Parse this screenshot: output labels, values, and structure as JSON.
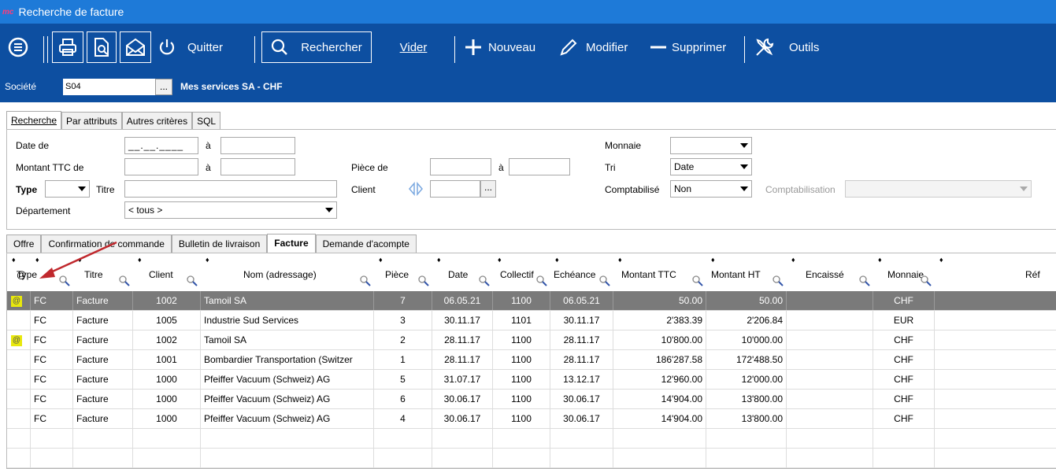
{
  "window": {
    "title": "Recherche de facture",
    "logo": "mc"
  },
  "toolbar": {
    "menu_icon": "menu-icon",
    "print_icon": "print-icon",
    "preview_icon": "print-preview-icon",
    "mail_icon": "mail-icon",
    "power_icon": "power-icon",
    "quit": "Quitter",
    "search": "Rechercher",
    "clear": "Vider",
    "new": "Nouveau",
    "edit": "Modifier",
    "delete": "Supprimer",
    "tools": "Outils"
  },
  "societe": {
    "label": "Société",
    "value": "S04",
    "button": "...",
    "name": "Mes services SA  -  CHF"
  },
  "search_tabs": [
    "Recherche",
    "Par attributs",
    "Autres critères",
    "SQL"
  ],
  "form": {
    "date_from": "Date de",
    "date_from_value": "__.__.____",
    "a": "à",
    "montant": "Montant TTC de",
    "piece": "Pièce de",
    "type": "Type",
    "titre": "Titre",
    "client": "Client",
    "departement": "Département",
    "departement_value": "< tous >",
    "monnaie": "Monnaie",
    "tri": "Tri",
    "tri_value": "Date",
    "comptabilise": "Comptabilisé",
    "comptabilise_value": "Non",
    "comptabilisation": "Comptabilisation",
    "dots": "..."
  },
  "doc_tabs": [
    "Offre",
    "Confirmation de commande",
    "Bulletin de livraison",
    "Facture",
    "Demande d'acompte"
  ],
  "columns": [
    "@",
    "Type",
    "Titre",
    "Client",
    "Nom (adressage)",
    "Pièce",
    "Date",
    "Collectif",
    "Echéance",
    "Montant TTC",
    "Montant HT",
    "Encaissé",
    "Monnaie",
    "Réf"
  ],
  "rows": [
    {
      "at": "@",
      "type": "FC",
      "titre": "Facture",
      "client": "1002",
      "nom": "Tamoil SA",
      "piece": "7",
      "date": "06.05.21",
      "collectif": "1100",
      "echeance": "06.05.21",
      "ttc": "50.00",
      "ht": "50.00",
      "enc": "",
      "monnaie": "CHF"
    },
    {
      "at": "",
      "type": "FC",
      "titre": "Facture",
      "client": "1005",
      "nom": "Industrie Sud Services",
      "piece": "3",
      "date": "30.11.17",
      "collectif": "1101",
      "echeance": "30.11.17",
      "ttc": "2'383.39",
      "ht": "2'206.84",
      "enc": "",
      "monnaie": "EUR"
    },
    {
      "at": "@",
      "type": "FC",
      "titre": "Facture",
      "client": "1002",
      "nom": "Tamoil SA",
      "piece": "2",
      "date": "28.11.17",
      "collectif": "1100",
      "echeance": "28.11.17",
      "ttc": "10'800.00",
      "ht": "10'000.00",
      "enc": "",
      "monnaie": "CHF"
    },
    {
      "at": "",
      "type": "FC",
      "titre": "Facture",
      "client": "1001",
      "nom": "Bombardier Transportation (Switzer",
      "piece": "1",
      "date": "28.11.17",
      "collectif": "1100",
      "echeance": "28.11.17",
      "ttc": "186'287.58",
      "ht": "172'488.50",
      "enc": "",
      "monnaie": "CHF"
    },
    {
      "at": "",
      "type": "FC",
      "titre": "Facture",
      "client": "1000",
      "nom": "Pfeiffer Vacuum (Schweiz) AG",
      "piece": "5",
      "date": "31.07.17",
      "collectif": "1100",
      "echeance": "13.12.17",
      "ttc": "12'960.00",
      "ht": "12'000.00",
      "enc": "",
      "monnaie": "CHF"
    },
    {
      "at": "",
      "type": "FC",
      "titre": "Facture",
      "client": "1000",
      "nom": "Pfeiffer Vacuum (Schweiz) AG",
      "piece": "6",
      "date": "30.06.17",
      "collectif": "1100",
      "echeance": "30.06.17",
      "ttc": "14'904.00",
      "ht": "13'800.00",
      "enc": "",
      "monnaie": "CHF"
    },
    {
      "at": "",
      "type": "FC",
      "titre": "Facture",
      "client": "1000",
      "nom": "Pfeiffer Vacuum (Schweiz) AG",
      "piece": "4",
      "date": "30.06.17",
      "collectif": "1100",
      "echeance": "30.06.17",
      "ttc": "14'904.00",
      "ht": "13'800.00",
      "enc": "",
      "monnaie": "CHF"
    }
  ],
  "colors": {
    "titlebar": "#1e7ad8",
    "toolbar": "#0d4fa1",
    "selected_row": "#7a7a7a",
    "at_highlight": "#e8e80c",
    "annotation_arrow": "#c0282d"
  }
}
